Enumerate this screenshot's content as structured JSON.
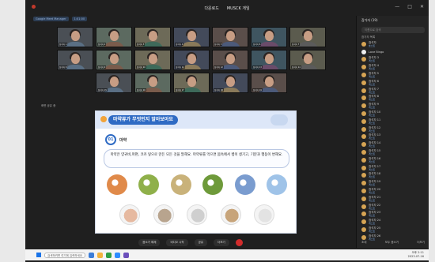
{
  "window": {
    "title_left": "다운로드",
    "title_right": "MUSCK 게임",
    "controls": [
      "—",
      "□",
      "✕"
    ]
  },
  "infobar": {
    "meeting_label": "Google Meet Manager",
    "badge": "1:01:00"
  },
  "participants": [
    {
      "name": "참석자 1"
    },
    {
      "name": "참석자 2"
    },
    {
      "name": "참석자 3"
    },
    {
      "name": "참석자 4"
    },
    {
      "name": "참석자 5"
    },
    {
      "name": "참석자 6"
    },
    {
      "name": "참석자 7"
    },
    {
      "name": "참석자 8"
    },
    {
      "name": "참석자 9"
    },
    {
      "name": "참석자 10"
    },
    {
      "name": "참석자 11"
    },
    {
      "name": "참석자 12"
    },
    {
      "name": "참석자 13"
    },
    {
      "name": "참석자 14"
    },
    {
      "name": "참석자 15"
    },
    {
      "name": "참석자 16"
    },
    {
      "name": "참석자 17"
    },
    {
      "name": "참석자 18"
    },
    {
      "name": "참석자 19"
    }
  ],
  "share_label": "화면 공유 중",
  "slide": {
    "title": "마약류가 무엇인지 알아보아요",
    "number": "01",
    "term": "마약",
    "description": "마약은 양귀비,마편, 코카 잎으로 만든 모든 것을 말해요. 마약류를 먹으면 몸속에서 병이 생기고, 기분과 행동이 변해요."
  },
  "slide_icons_row1": [
    "poppy-icon",
    "leaf-icon",
    "powder-icon",
    "herb-icon",
    "syringe-icon",
    "pill-bottle-icon"
  ],
  "slide_icons_row2": [
    "cola-icon",
    "mushroom-icon",
    "pills-icon",
    "plant-icon",
    "tablets-icon"
  ],
  "controls": {
    "mic": "음소거 해제",
    "video": "비디오 시작",
    "share": "공유",
    "more": "더보기",
    "end": "종료"
  },
  "panel": {
    "title": "참가자 (19)",
    "search_placeholder": "이름으로 검색",
    "section": "참가자 목록",
    "items": [
      {
        "name": "참석자",
        "sub": "호스트"
      },
      {
        "name": "Love Bingo",
        "sub": ""
      },
      {
        "name": "참석자 3",
        "sub": "게스트"
      },
      {
        "name": "참석자 4",
        "sub": "게스트"
      },
      {
        "name": "참석자 5",
        "sub": "게스트"
      },
      {
        "name": "참석자 6",
        "sub": "게스트"
      },
      {
        "name": "참석자 7",
        "sub": "게스트"
      },
      {
        "name": "참석자 8",
        "sub": "게스트"
      },
      {
        "name": "참석자 9",
        "sub": "게스트"
      },
      {
        "name": "참석자 10",
        "sub": "게스트"
      },
      {
        "name": "참석자 11",
        "sub": "게스트"
      },
      {
        "name": "참석자 12",
        "sub": "게스트"
      },
      {
        "name": "참석자 13",
        "sub": "게스트"
      },
      {
        "name": "참석자 14",
        "sub": "게스트"
      },
      {
        "name": "참석자 15",
        "sub": "게스트"
      },
      {
        "name": "참석자 16",
        "sub": "게스트"
      },
      {
        "name": "참석자 17",
        "sub": "게스트"
      },
      {
        "name": "참석자 18",
        "sub": "게스트"
      },
      {
        "name": "참석자 19",
        "sub": "게스트"
      },
      {
        "name": "참석자 20",
        "sub": "게스트"
      },
      {
        "name": "참석자 21",
        "sub": "게스트"
      },
      {
        "name": "참석자 22",
        "sub": "게스트"
      },
      {
        "name": "참석자 23",
        "sub": "게스트"
      },
      {
        "name": "참석자 24",
        "sub": "게스트"
      },
      {
        "name": "참석자 25",
        "sub": "게스트"
      },
      {
        "name": "참석자 26",
        "sub": "게스트"
      }
    ],
    "footer_left": "초대",
    "footer_mid": "모두 음소거",
    "footer_right": "더보기"
  },
  "taskbar": {
    "search": "검색하려면 여기에 입력하세요",
    "time": "오후 2:11",
    "date": "2023-07-16"
  },
  "colors": {
    "accent": "#2f6bc4",
    "end": "#d22c2c"
  }
}
